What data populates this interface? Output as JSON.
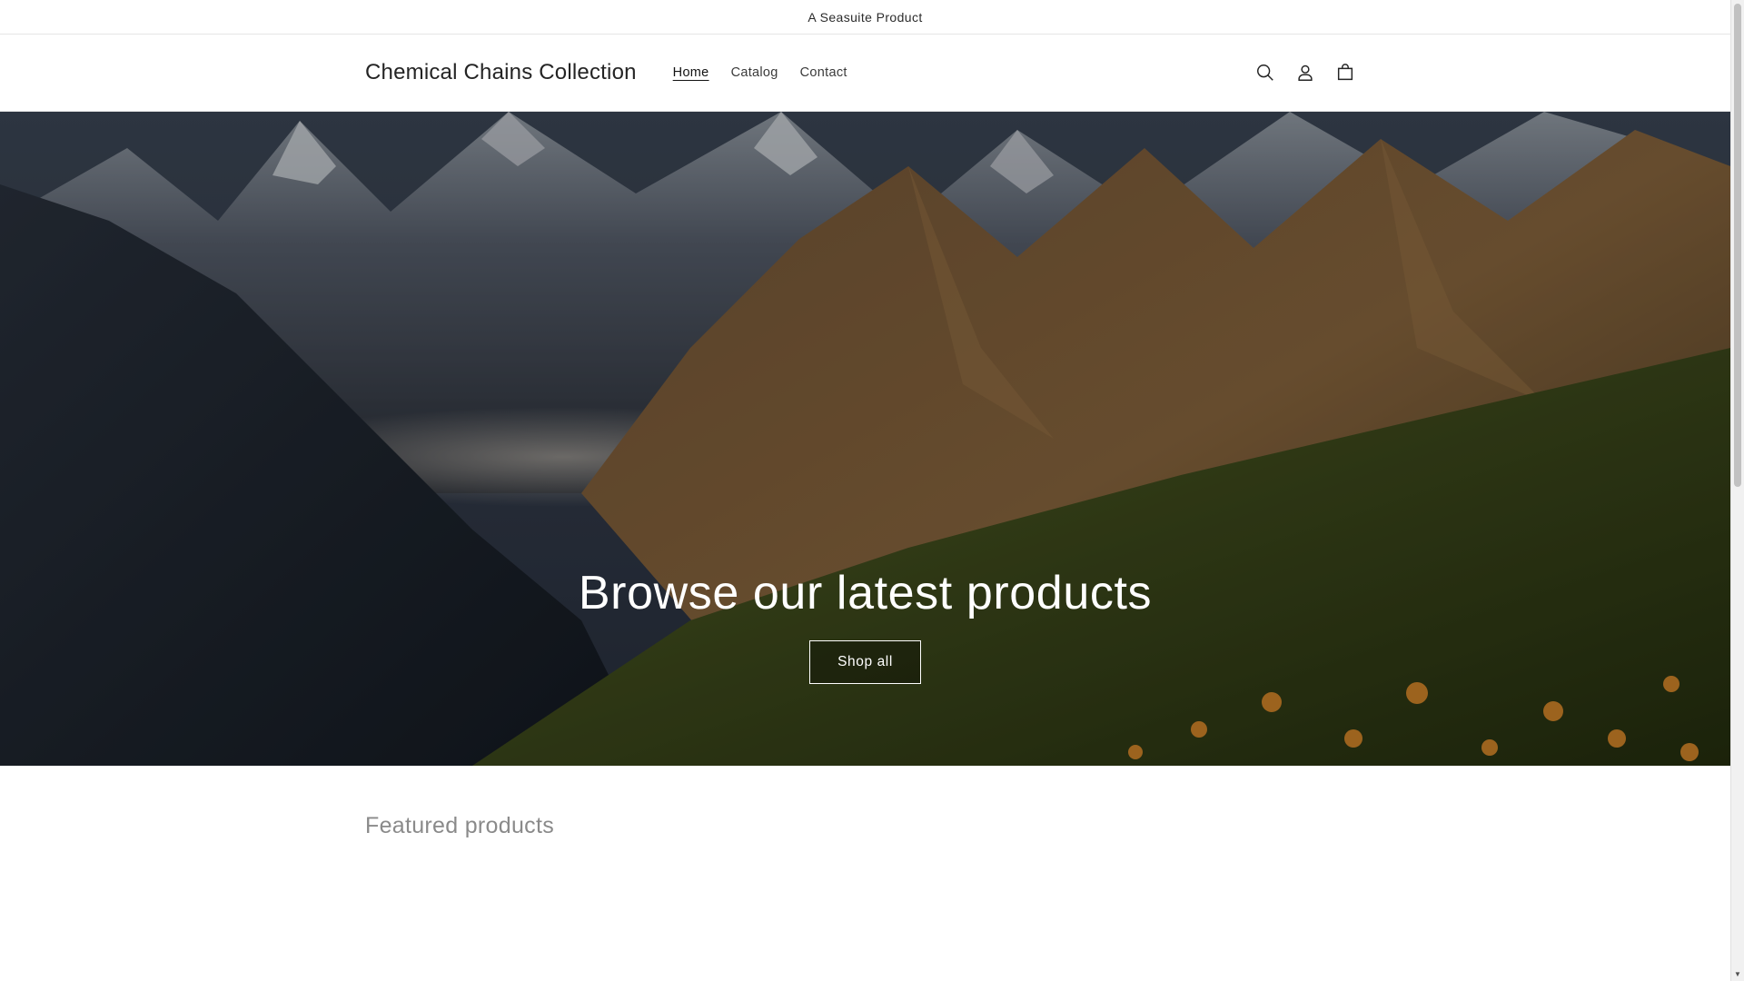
{
  "announcement": {
    "text": "A Seasuite Product"
  },
  "header": {
    "logo": "Chemical Chains Collection",
    "nav": [
      {
        "label": "Home",
        "active": true
      },
      {
        "label": "Catalog",
        "active": false
      },
      {
        "label": "Contact",
        "active": false
      }
    ],
    "icons": [
      "search-icon",
      "account-icon",
      "cart-icon"
    ]
  },
  "hero": {
    "title": "Browse our latest products",
    "button_label": "Shop all"
  },
  "featured": {
    "title": "Featured products"
  },
  "colors": {
    "text": "#121212",
    "muted": "#8a8a8a",
    "border": "#e6e6e6",
    "hero_text": "#ffffff"
  }
}
